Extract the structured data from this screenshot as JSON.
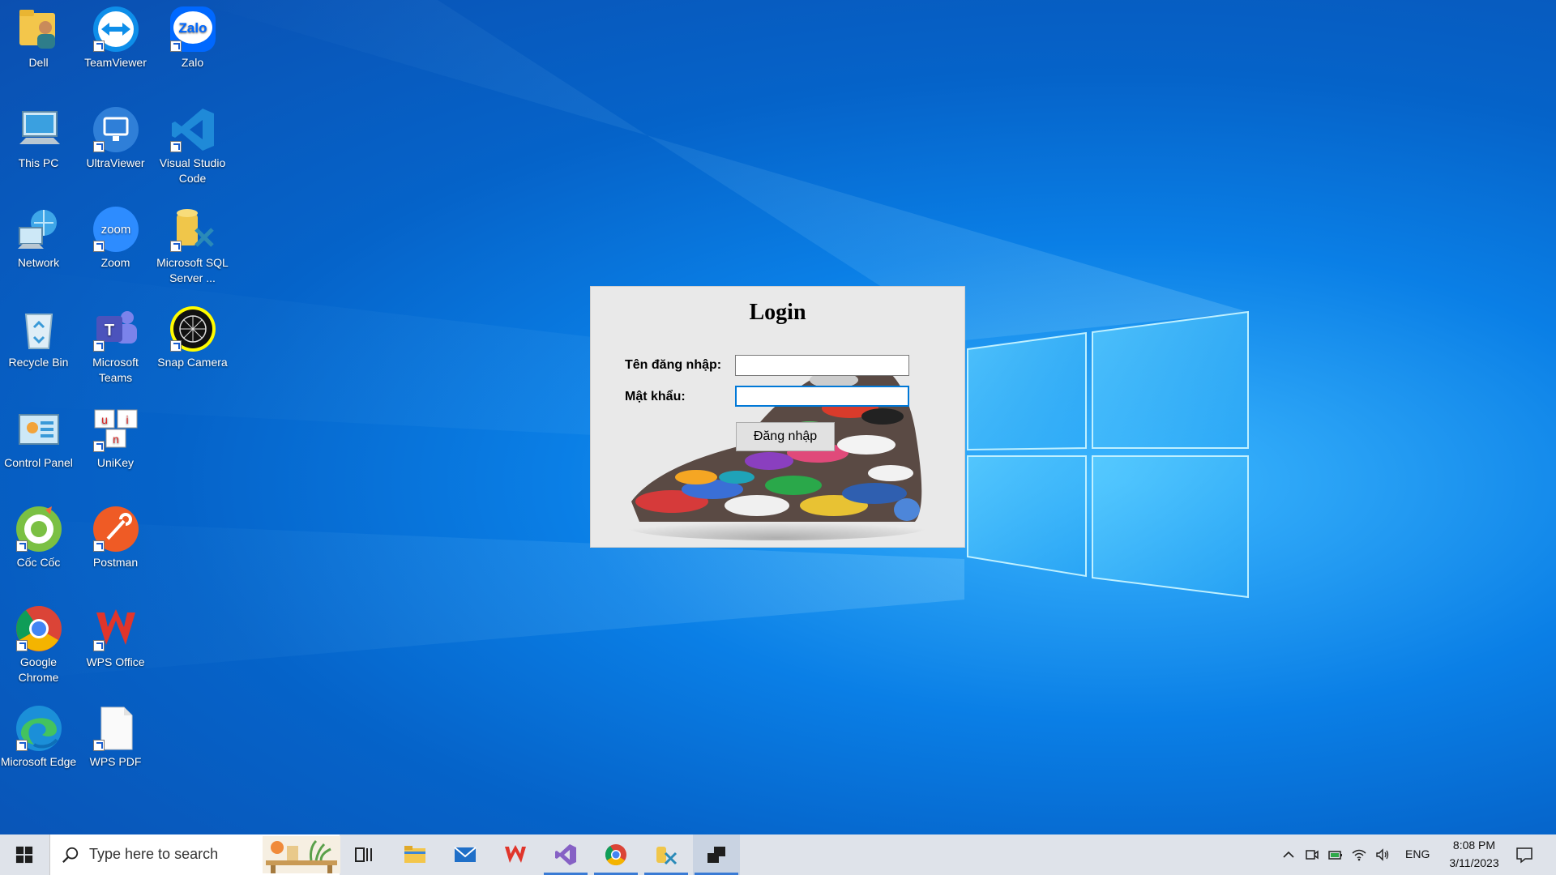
{
  "desktop": {
    "icons": [
      {
        "label": "Dell",
        "icon": "user-folder-icon"
      },
      {
        "label": "TeamViewer",
        "icon": "teamviewer-icon"
      },
      {
        "label": "Zalo",
        "icon": "zalo-icon",
        "text": "Zalo"
      },
      {
        "label": "This PC",
        "icon": "computer-icon"
      },
      {
        "label": "UltraViewer",
        "icon": "ultraviewer-icon"
      },
      {
        "label": "Visual Studio Code",
        "icon": "vscode-icon"
      },
      {
        "label": "Network",
        "icon": "network-icon"
      },
      {
        "label": "Zoom",
        "icon": "zoom-icon",
        "text": "zoom"
      },
      {
        "label": "Microsoft SQL Server ...",
        "icon": "sql-server-icon"
      },
      {
        "label": "Recycle Bin",
        "icon": "recycle-bin-icon"
      },
      {
        "label": "Microsoft Teams",
        "icon": "teams-icon",
        "text": "T"
      },
      {
        "label": "Snap Camera",
        "icon": "snap-camera-icon"
      },
      {
        "label": "Control Panel",
        "icon": "control-panel-icon"
      },
      {
        "label": "UniKey",
        "icon": "unikey-icon"
      },
      {
        "label": "Cốc Cốc",
        "icon": "coccoc-icon"
      },
      {
        "label": "Postman",
        "icon": "postman-icon"
      },
      {
        "label": "Google Chrome",
        "icon": "chrome-icon"
      },
      {
        "label": "WPS Office",
        "icon": "wps-office-icon"
      },
      {
        "label": "Microsoft Edge",
        "icon": "edge-icon"
      },
      {
        "label": "WPS PDF",
        "icon": "wps-pdf-icon"
      }
    ]
  },
  "login": {
    "title": "Login",
    "username_label": "Tên đăng nhập:",
    "username_value": "",
    "password_label": "Mật khẩu:",
    "password_value": "",
    "submit_label": "Đăng nhập"
  },
  "taskbar": {
    "search_placeholder": "Type here to search",
    "language": "ENG",
    "time": "8:08 PM",
    "date": "3/11/2023",
    "apps": [
      "task-view-icon",
      "file-explorer-icon",
      "mail-icon",
      "wps-office-icon",
      "visual-studio-icon",
      "chrome-icon",
      "sql-server-config-icon",
      "app-window-icon"
    ]
  },
  "colors": {
    "accent": "#0078d7",
    "taskbar_bg": "#dfe3ea",
    "login_bg": "#e9e9e9"
  }
}
